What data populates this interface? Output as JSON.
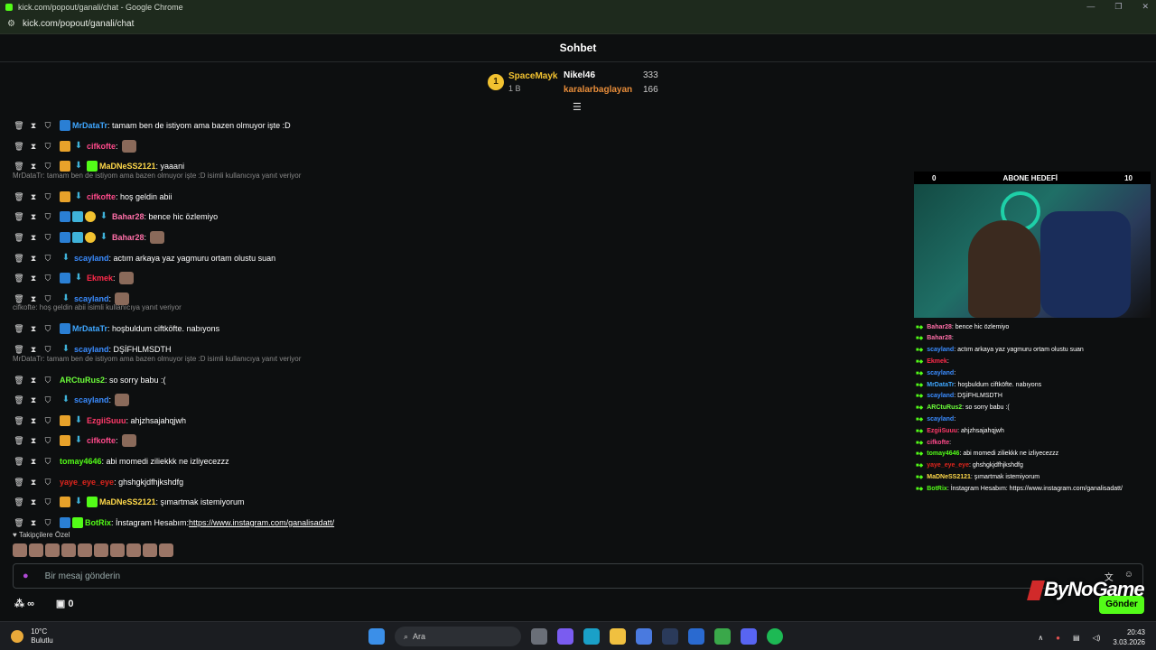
{
  "window": {
    "title": "kick.com/popout/ganali/chat - Google Chrome",
    "url": "kick.com/popout/ganali/chat"
  },
  "header": {
    "title": "Sohbet"
  },
  "leaderboard": {
    "first": {
      "rank": "1",
      "name": "SpaceMayk",
      "value": "1 B"
    },
    "second": {
      "name": "Nikel46",
      "value": "333"
    },
    "third": {
      "name": "karalarbaglayan",
      "value": "166"
    }
  },
  "chat": {
    "messages": [
      {
        "user": "MrDataTr",
        "color": "#3fa7ff",
        "text": ": tamam ben de istiyom ama bazen olmuyor işte :D"
      },
      {
        "user": "cifkofte",
        "color": "#ff4a8b",
        "text": ":"
      },
      {
        "user": "MaDNeSS2121",
        "color": "#ffd94a",
        "text": ": yaaani"
      },
      {
        "user": "cifkofte",
        "color": "#ff4a8b",
        "text": ": hoş geldin abii"
      },
      {
        "user": "Bahar28",
        "color": "#ff6fa8",
        "text": ": bence hic özlemiyo"
      },
      {
        "user": "Bahar28",
        "color": "#ff6fa8",
        "text": ":"
      },
      {
        "user": "scayland",
        "color": "#3a8cff",
        "text": ": actım arkaya yaz yagmuru ortam olustu suan"
      },
      {
        "user": "Ekmek",
        "color": "#ff2a4a",
        "text": ":"
      },
      {
        "user": "scayland",
        "color": "#3a8cff",
        "text": ":"
      },
      {
        "user": "MrDataTr",
        "color": "#3fa7ff",
        "text": ": hoşbuldum ciftköfte. nabıyons"
      },
      {
        "user": "scayland",
        "color": "#3a8cff",
        "text": ": DŞİFHLMSDTH"
      },
      {
        "user": "ARCtuRus2",
        "color": "#6dff3a",
        "text": ": so sorry babu :("
      },
      {
        "user": "scayland",
        "color": "#3a8cff",
        "text": ":"
      },
      {
        "user": "EzgiiSuuu",
        "color": "#ff3a6a",
        "text": ": ahjzhsajahqjwh"
      },
      {
        "user": "cifkofte",
        "color": "#ff4a8b",
        "text": ":"
      },
      {
        "user": "tomay4646",
        "color": "#53fc18",
        "text": ": abi momedi ziliekkk ne izliyecezzz"
      },
      {
        "user": "yaye_eye_eye",
        "color": "#e0251d",
        "text": ": ghshgkjdfhjkshdfg"
      },
      {
        "user": "MaDNeSS2121",
        "color": "#ffd94a",
        "text": ": şımartmak istemiyorum"
      },
      {
        "user": "BotRix",
        "color": "#53fc18",
        "text": ": İnstagram Hesabım: ",
        "link": "https://www.instagram.com/ganalisadatt/"
      }
    ],
    "replies": [
      "MrDataTr: tamam ben de istiyom ama bazen olmuyor işte :D isimli kullanıcıya yanıt veriyor",
      "cifkofte: hoş geldin abii isimli kullanıcıya yanıt veriyor",
      "MrDataTr: tamam ben de istiyom ama bazen olmuyor işte :D isimli kullanıcıya yanıt veriyor"
    ]
  },
  "followers_only": "Takipçilere Özel",
  "input": {
    "placeholder": "Bir mesaj gönderin"
  },
  "bottom_bar": {
    "left_value": "∞",
    "count": "0"
  },
  "send_button": "Gönder",
  "watermark": "ByNoGame",
  "overlay": {
    "goal_left": "0",
    "goal_title": "ABONE HEDEFİ",
    "goal_right": "10",
    "messages": [
      {
        "user": "Bahar28",
        "color": "#ff6fa8",
        "text": " : bence hic özlemiyo"
      },
      {
        "user": "Bahar28",
        "color": "#ff6fa8",
        "text": " :"
      },
      {
        "user": "scayland",
        "color": "#3a8cff",
        "text": " : actım arkaya yaz yagmuru ortam olustu suan"
      },
      {
        "user": "Ekmek",
        "color": "#ff2a4a",
        "text": " :"
      },
      {
        "user": "scayland",
        "color": "#3a8cff",
        "text": " :"
      },
      {
        "user": "MrDataTr",
        "color": "#3fa7ff",
        "text": " : hoşbuldum ciftköfte. nabıyons"
      },
      {
        "user": "scayland",
        "color": "#3a8cff",
        "text": " : DŞİFHLMSDTH"
      },
      {
        "user": "ARCtuRus2",
        "color": "#6dff3a",
        "text": " : so sorry babu :("
      },
      {
        "user": "scayland",
        "color": "#3a8cff",
        "text": " :"
      },
      {
        "user": "EzgiiSuuu",
        "color": "#ff3a6a",
        "text": " : ahjzhsajahqjwh"
      },
      {
        "user": "cifkofte",
        "color": "#ff4a8b",
        "text": " :"
      },
      {
        "user": "tomay4646",
        "color": "#53fc18",
        "text": " : abi momedi ziliekkk ne izliyecezzz"
      },
      {
        "user": "yaye_eye_eye",
        "color": "#e0251d",
        "text": " : ghshgkjdfhjkshdfg"
      },
      {
        "user": "MaDNeSS2121",
        "color": "#ffd94a",
        "text": " : şımartmak istemiyorum"
      },
      {
        "user": "BotRix",
        "color": "#53fc18",
        "text": " : İnstagram Hesabım: https://www.instagram.com/ganalisadatt/"
      }
    ]
  },
  "taskbar": {
    "weather_temp": "10°C",
    "weather_desc": "Bulutlu",
    "search_placeholder": "Ara",
    "time": "20:43",
    "date": "3.03.2026"
  }
}
